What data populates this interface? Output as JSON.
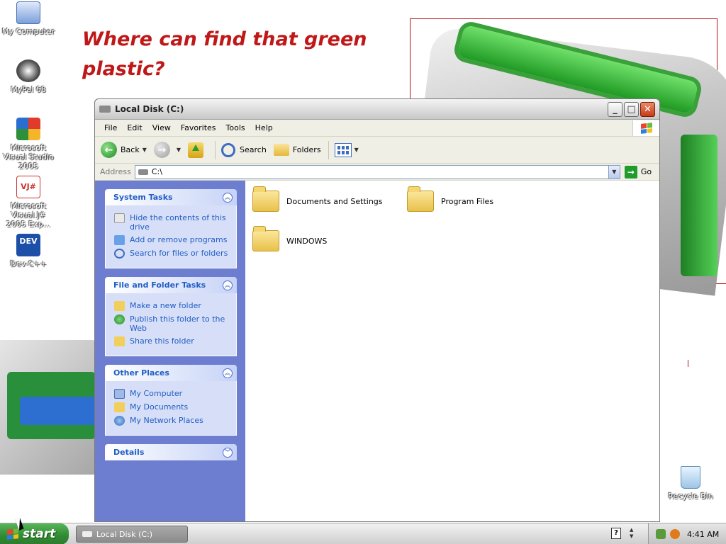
{
  "desktop": {
    "headline": "Where can find that green plastic?",
    "icons": [
      {
        "label": "My Computer",
        "icon": "my-computer-icon"
      },
      {
        "label": "MyPal 68",
        "icon": "mypal-icon"
      },
      {
        "label": "Microsoft Visual Studio 2005",
        "icon": "visual-studio-icon"
      },
      {
        "label": "Microsoft Visual J# 2005 Exp...",
        "icon": "visual-jsharp-icon"
      },
      {
        "label": "Dev-C++",
        "icon": "dev-cpp-icon"
      },
      {
        "label": "Recycle Bin",
        "icon": "recycle-bin-icon"
      }
    ],
    "dev_icon_text": "DEV",
    "vj_icon_text": "VJ#"
  },
  "window": {
    "title": "Local Disk (C:)",
    "buttons": {
      "minimize": "_",
      "maximize": "□",
      "close": "✕"
    },
    "menu": [
      "File",
      "Edit",
      "View",
      "Favorites",
      "Tools",
      "Help"
    ],
    "toolbar": {
      "back": "Back",
      "search": "Search",
      "folders": "Folders"
    },
    "address": {
      "label": "Address",
      "value": "C:\\",
      "go": "Go"
    },
    "panels": [
      {
        "title": "System Tasks",
        "chevron": "up",
        "items": [
          {
            "label": "Hide the contents of this drive",
            "icon": "hide-contents-icon"
          },
          {
            "label": "Add or remove programs",
            "icon": "add-remove-programs-icon"
          },
          {
            "label": "Search for files or folders",
            "icon": "search-icon"
          }
        ]
      },
      {
        "title": "File and Folder Tasks",
        "chevron": "up",
        "items": [
          {
            "label": "Make a new folder",
            "icon": "new-folder-icon"
          },
          {
            "label": "Publish this folder to the Web",
            "icon": "publish-web-icon"
          },
          {
            "label": "Share this folder",
            "icon": "share-folder-icon"
          }
        ]
      },
      {
        "title": "Other Places",
        "chevron": "up",
        "items": [
          {
            "label": "My Computer",
            "icon": "my-computer-icon"
          },
          {
            "label": "My Documents",
            "icon": "my-documents-icon"
          },
          {
            "label": "My Network Places",
            "icon": "network-places-icon"
          }
        ]
      },
      {
        "title": "Details",
        "chevron": "down",
        "items": []
      }
    ],
    "files": [
      {
        "name": "Documents and Settings",
        "icon": "folder-icon"
      },
      {
        "name": "Program Files",
        "icon": "folder-icon"
      },
      {
        "name": "WINDOWS",
        "icon": "folder-icon"
      }
    ]
  },
  "taskbar": {
    "start": "start",
    "task_item": "Local Disk (C:)",
    "help_icon_text": "?",
    "clock": "4:41 AM"
  },
  "colors": {
    "headline": "#c01818",
    "task_link": "#215dc6",
    "task_pane": "#6d7dcf",
    "start_button": "#2e8a31"
  }
}
